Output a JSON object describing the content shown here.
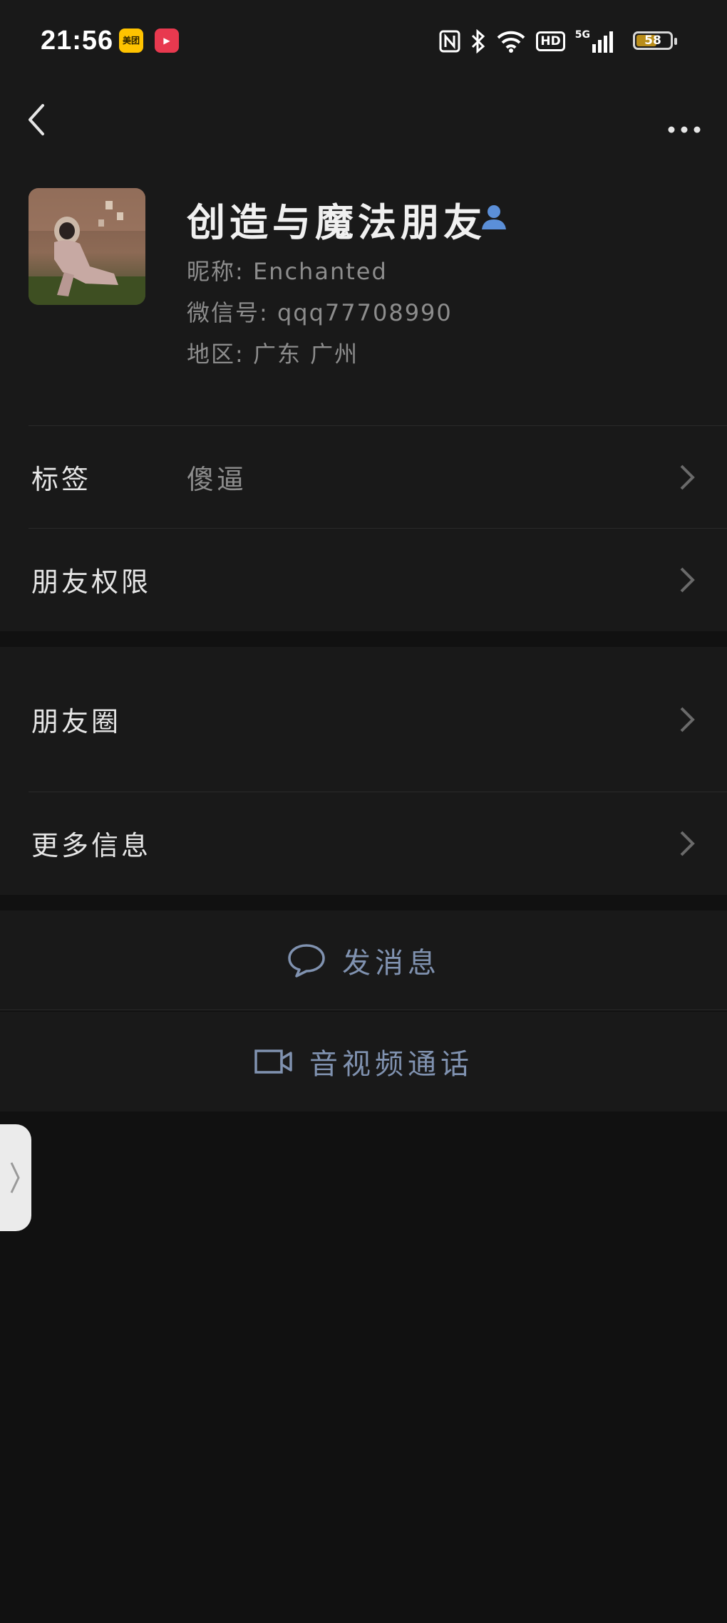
{
  "status_bar": {
    "time": "21:56",
    "app_badges": [
      "美团",
      "▶"
    ],
    "icons": [
      "nfc-icon",
      "bluetooth-icon",
      "wifi-icon",
      "hd-icon",
      "5g-signal-icon"
    ],
    "hd_label": "HD",
    "network_label": "5G",
    "battery": "58"
  },
  "profile": {
    "name": "创造与魔法朋友",
    "nickname": "昵称: Enchanted",
    "wechat_id": "微信号: qqq77708990",
    "region": "地区: 广东 广州"
  },
  "rows": {
    "tags_label": "标签",
    "tags_value": "傻逼",
    "permissions_label": "朋友权限",
    "moments_label": "朋友圈",
    "more_info_label": "更多信息"
  },
  "actions": {
    "message_label": "发消息",
    "call_label": "音视频通话"
  },
  "colors": {
    "background": "#111111",
    "card": "#191919",
    "accent": "#8092b0",
    "person_icon": "#5b8fd8"
  }
}
